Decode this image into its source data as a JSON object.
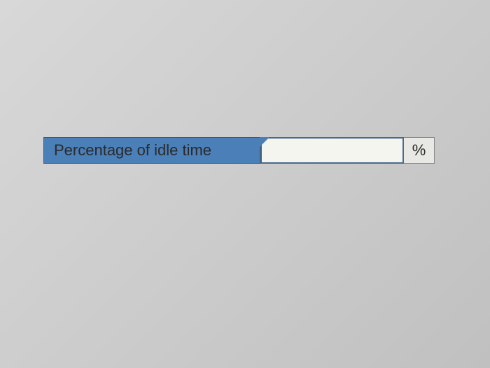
{
  "form": {
    "idle_time": {
      "label": "Percentage of idle time",
      "value": "",
      "unit": "%"
    }
  }
}
